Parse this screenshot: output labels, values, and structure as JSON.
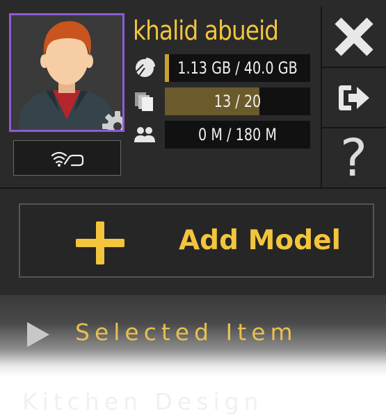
{
  "profile": {
    "username": "khalid abueid",
    "stats": [
      {
        "icon": "storage-pie-icon",
        "label": "1.13 GB / 40.0 GB",
        "fraction": 0.028
      },
      {
        "icon": "models-stack-icon",
        "label": "13 / 20",
        "fraction": 0.65
      },
      {
        "icon": "users-icon",
        "label": "0 M / 180 M",
        "fraction": 0.0
      }
    ],
    "avatar_icon": "user-avatar-icon",
    "settings_icon": "gear-icon",
    "connection_icon": "wifi-headset-icon"
  },
  "side_buttons": {
    "close_icon": "close-icon",
    "logout_icon": "logout-icon",
    "help_label": "?"
  },
  "add_model": {
    "label": "Add Model",
    "icon": "plus-icon"
  },
  "list": {
    "selected_item": "Selected Item",
    "second_item": "Kitchen Design",
    "selected_icon": "play-icon"
  },
  "colors": {
    "accent": "#f2c53d",
    "avatar_border": "#8e5bd6",
    "panel_bg": "#2a2a2a",
    "bar_fill": "#6b5b2c"
  }
}
